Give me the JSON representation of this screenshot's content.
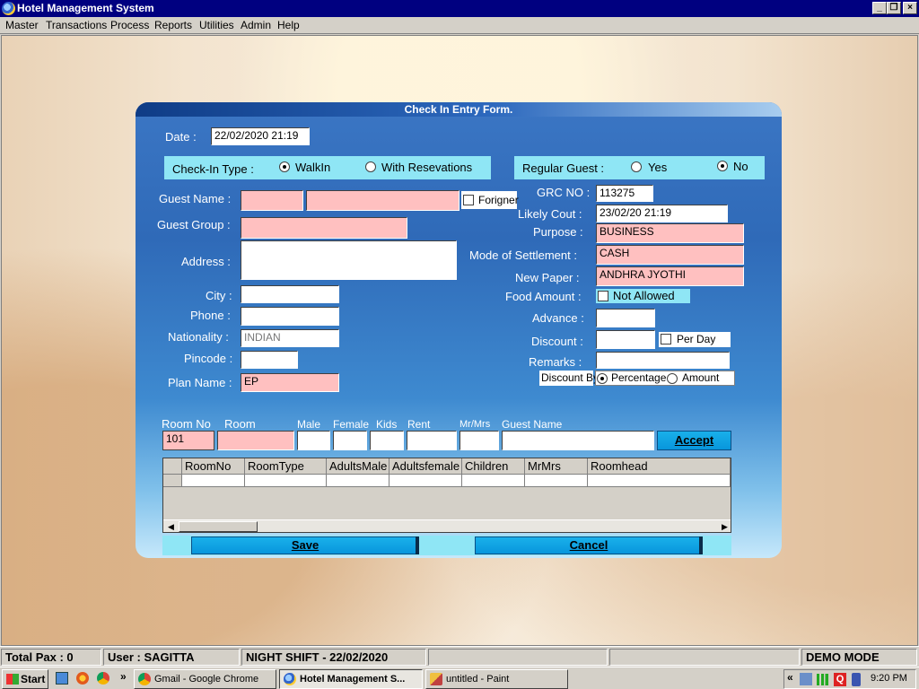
{
  "window": {
    "title": "Hotel Management System"
  },
  "menu": [
    "Master",
    "Transactions",
    "Process",
    "Reports",
    "Utilities",
    "Admin",
    "Help"
  ],
  "form": {
    "title": "Check In Entry Form.",
    "date_label": "Date :",
    "date_value": "22/02/2020 21:19",
    "checkin_type_label": "Check-In Type :",
    "checkin_walkin": "WalkIn",
    "checkin_reservations": "With Resevations",
    "regular_guest_label": "Regular Guest :",
    "regular_yes": "Yes",
    "regular_no": "No",
    "guest_name_label": "Guest Name :",
    "foreigner_label": "Forigner",
    "guest_group_label": "Guest Group :",
    "address_label": "Address :",
    "city_label": "City :",
    "phone_label": "Phone :",
    "nationality_label": "Nationality :",
    "nationality_value": "INDIAN",
    "pincode_label": "Pincode :",
    "plan_name_label": "Plan Name :",
    "plan_name_value": "EP",
    "grc_label": "GRC NO :",
    "grc_value": "113275",
    "likely_cout_label": "Likely Cout :",
    "likely_cout_value": "23/02/20 21:19",
    "purpose_label": "Purpose :",
    "purpose_value": "BUSINESS",
    "settlement_label": "Mode of Settlement :",
    "settlement_value": "CASH",
    "newpaper_label": "New Paper :",
    "newpaper_value": "ANDHRA JYOTHI",
    "food_label": "Food Amount :",
    "food_value": "Not Allowed",
    "advance_label": "Advance :",
    "discount_label": "Discount :",
    "perday_label": "Per Day",
    "remarks_label": "Remarks :",
    "discount_by_label": "Discount By",
    "discount_percentage": "Percentage",
    "discount_amount": "Amount",
    "room_headers": [
      "Room No",
      "Room",
      "Male",
      "Female",
      "Kids",
      "Rent",
      "Mr/Mrs",
      "Guest Name"
    ],
    "room_no_value": "101",
    "accept_label": "Accept",
    "grid_headers": [
      "RoomNo",
      "RoomType",
      "AdultsMale",
      "Adultsfemale",
      "Children",
      "MrMrs",
      "Roomhead"
    ],
    "save_label": "Save",
    "cancel_label": "Cancel"
  },
  "status": {
    "total_pax": "Total Pax : 0",
    "user": "User : SAGITTA",
    "shift": "NIGHT SHIFT - 22/02/2020",
    "mode": "DEMO MODE"
  },
  "taskbar": {
    "start": "Start",
    "overflow": "»",
    "tasks": [
      "Gmail - Google Chrome",
      "Hotel Management S...",
      "untitled - Paint"
    ],
    "tray_overflow": "«",
    "clock": "9:20 PM"
  },
  "colors": {
    "title_bar": "#000080",
    "pink_field": "#ffc0c0",
    "cyan_bar": "#8fe6f5",
    "button_blue": "#0896dc"
  }
}
